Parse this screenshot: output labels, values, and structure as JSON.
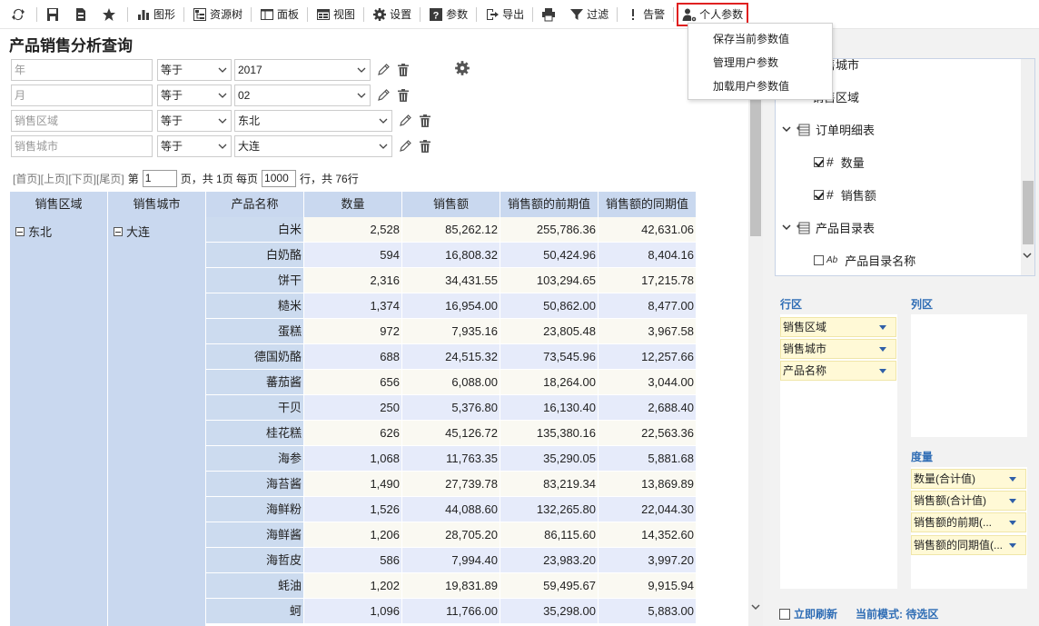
{
  "toolbar": {
    "chart": "图形",
    "resource_tree": "资源树",
    "panel": "面板",
    "view": "视图",
    "settings": "设置",
    "params": "参数",
    "export": "导出",
    "filter": "过滤",
    "alert": "告警",
    "personal_params": "个人参数"
  },
  "dropdown": {
    "items": [
      "保存当前参数值",
      "管理用户参数",
      "加载用户参数值"
    ]
  },
  "page_title": "产品销售分析查询",
  "filters": [
    {
      "field": "年",
      "op": "等于",
      "value": "2017"
    },
    {
      "field": "月",
      "op": "等于",
      "value": "02"
    },
    {
      "field": "销售区域",
      "op": "等于",
      "value": "东北"
    },
    {
      "field": "销售城市",
      "op": "等于",
      "value": "大连"
    }
  ],
  "pager": {
    "first": "[首页]",
    "prev": "[上页]",
    "next": "[下页]",
    "last": "[尾页]",
    "page_prefix": "第",
    "page": "1",
    "page_suffix": "页，共 1页 每页",
    "page_size": "1000",
    "rows_suffix": "行，共 76行"
  },
  "table": {
    "headers": [
      "销售区域",
      "销售城市",
      "产品名称",
      "数量",
      "销售额",
      "销售额的前期值",
      "销售额的同期值"
    ],
    "region": "东北",
    "city": "大连",
    "rows": [
      {
        "name": "白米",
        "qty": "2,528",
        "sales": "85,262.12",
        "prev": "255,786.36",
        "same": "42,631.06"
      },
      {
        "name": "白奶酪",
        "qty": "594",
        "sales": "16,808.32",
        "prev": "50,424.96",
        "same": "8,404.16"
      },
      {
        "name": "饼干",
        "qty": "2,316",
        "sales": "34,431.55",
        "prev": "103,294.65",
        "same": "17,215.78"
      },
      {
        "name": "糙米",
        "qty": "1,374",
        "sales": "16,954.00",
        "prev": "50,862.00",
        "same": "8,477.00"
      },
      {
        "name": "蛋糕",
        "qty": "972",
        "sales": "7,935.16",
        "prev": "23,805.48",
        "same": "3,967.58"
      },
      {
        "name": "德国奶酪",
        "qty": "688",
        "sales": "24,515.32",
        "prev": "73,545.96",
        "same": "12,257.66"
      },
      {
        "name": "蕃茄酱",
        "qty": "656",
        "sales": "6,088.00",
        "prev": "18,264.00",
        "same": "3,044.00"
      },
      {
        "name": "干贝",
        "qty": "250",
        "sales": "5,376.80",
        "prev": "16,130.40",
        "same": "2,688.40"
      },
      {
        "name": "桂花糕",
        "qty": "626",
        "sales": "45,126.72",
        "prev": "135,380.16",
        "same": "22,563.36"
      },
      {
        "name": "海参",
        "qty": "1,068",
        "sales": "11,763.35",
        "prev": "35,290.05",
        "same": "5,881.68"
      },
      {
        "name": "海苔酱",
        "qty": "1,490",
        "sales": "27,739.78",
        "prev": "83,219.34",
        "same": "13,869.89"
      },
      {
        "name": "海鲜粉",
        "qty": "1,526",
        "sales": "44,088.60",
        "prev": "132,265.80",
        "same": "22,044.30"
      },
      {
        "name": "海鲜酱",
        "qty": "1,206",
        "sales": "28,705.20",
        "prev": "86,115.60",
        "same": "14,352.60"
      },
      {
        "name": "海哲皮",
        "qty": "586",
        "sales": "7,994.40",
        "prev": "23,983.20",
        "same": "3,997.20"
      },
      {
        "name": "蚝油",
        "qty": "1,202",
        "sales": "19,831.89",
        "prev": "59,495.67",
        "same": "9,915.94"
      },
      {
        "name": "蚵",
        "qty": "1,096",
        "sales": "11,766.00",
        "prev": "35,298.00",
        "same": "5,883.00"
      }
    ]
  },
  "tree": {
    "items": [
      {
        "label": "销售城市"
      },
      {
        "label": "销售区域"
      },
      {
        "label": "订单明细表"
      },
      {
        "label": "数量"
      },
      {
        "label": "销售额"
      },
      {
        "label": "产品目录表"
      },
      {
        "label": "产品目录名称"
      }
    ]
  },
  "areas": {
    "row_label": "行区",
    "col_label": "列区",
    "measure_label": "度量",
    "row_items": [
      "销售区域",
      "销售城市",
      "产品名称"
    ],
    "measure_items": [
      "数量(合计值)",
      "销售额(合计值)",
      "销售额的前期(...",
      "销售额的同期值(..."
    ]
  },
  "bottom": {
    "refresh": "立即刷新",
    "mode": "当前模式: 待选区"
  }
}
